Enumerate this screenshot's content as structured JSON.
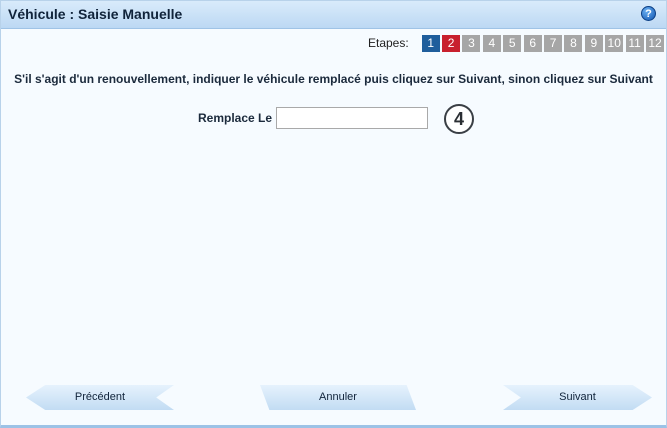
{
  "window": {
    "title": "Véhicule : Saisie Manuelle",
    "help_icon": "?"
  },
  "steps": {
    "label": "Etapes:",
    "items": [
      "1",
      "2",
      "3",
      "4",
      "5",
      "6",
      "7",
      "8",
      "9",
      "10",
      "11",
      "12"
    ],
    "completed_step": "1",
    "current_step": "2"
  },
  "instruction": "S'il s'agit d'un renouvellement, indiquer le véhicule remplacé puis cliquez sur Suivant, sinon cliquez sur Suivant",
  "form": {
    "replace_label": "Remplace Le",
    "replace_value": "",
    "badge": "4"
  },
  "buttons": {
    "previous": "Précédent",
    "cancel": "Annuler",
    "next": "Suivant"
  },
  "colors": {
    "step_done": "#1f5e9c",
    "step_current": "#c8202e",
    "step_pending": "#a6a6a6",
    "titlebar": "#cfe3f6"
  }
}
